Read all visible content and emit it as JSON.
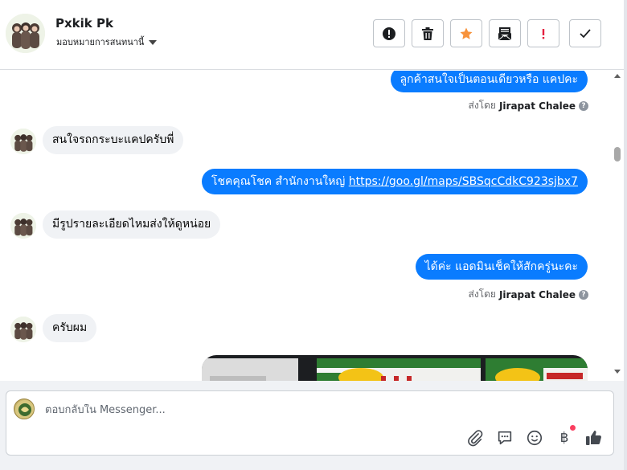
{
  "header": {
    "contact_name": "Pxkik Pk",
    "assign_label": "มอบหมายการสนทนานี้",
    "actions": [
      {
        "name": "mark-spam-button",
        "icon": "alert-circle-icon"
      },
      {
        "name": "delete-button",
        "icon": "trash-icon"
      },
      {
        "name": "star-button",
        "icon": "star-icon"
      },
      {
        "name": "mark-unread-button",
        "icon": "envelope-icon"
      },
      {
        "name": "follow-up-button",
        "icon": "exclamation-icon"
      },
      {
        "name": "mark-done-button",
        "icon": "check-icon"
      }
    ]
  },
  "messages": [
    {
      "direction": "out",
      "text": "ลูกค้าสนใจเป็นตอนเดียวหรือ แคปคะ",
      "sent_by_label": "ส่งโดย",
      "sent_by_name": "Jirapat Chalee"
    },
    {
      "direction": "in",
      "text": "สนใจรถกระบะแคปครับพี่"
    },
    {
      "direction": "out",
      "text_prefix": "โชคคุณโชค สำนักงานใหญ่ ",
      "link": "https://goo.gl/maps/SBSqcCdkC923sjbx7"
    },
    {
      "direction": "in",
      "text": "มีรูปรายละเอียดไหมส่งให้ดูหน่อย"
    },
    {
      "direction": "out",
      "text": "ได้ค่ะ แอดมินเช็คให้สักครู่นะคะ",
      "sent_by_label": "ส่งโดย",
      "sent_by_name": "Jirapat Chalee"
    },
    {
      "direction": "in",
      "text": "ครับผม"
    }
  ],
  "composer": {
    "placeholder": "ตอบกลับใน Messenger...",
    "icons": [
      "paperclip-icon",
      "saved-reply-icon",
      "emoji-icon",
      "baht-payment-icon",
      "like-icon"
    ],
    "baht_symbol": "฿"
  },
  "colors": {
    "outgoing_bubble": "#0a7cff",
    "incoming_bubble": "#f0f2f5",
    "star": "#f7923b",
    "follow_up": "#e41e3f"
  }
}
